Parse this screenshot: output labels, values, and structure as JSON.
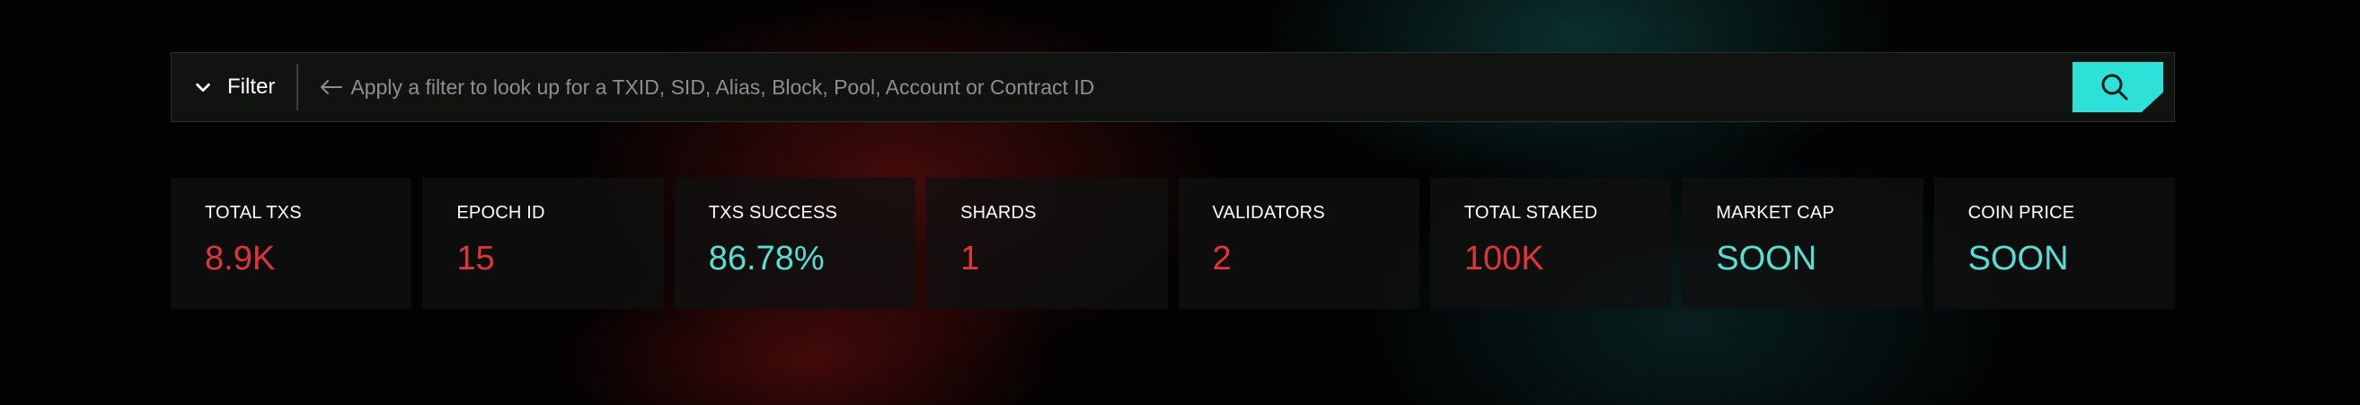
{
  "search": {
    "filter_label": "Filter",
    "placeholder": "Apply a filter to look up for a TXID, SID, Alias, Block, Pool, Account or Contract ID",
    "icons": {
      "filter_toggle": "chevron-down-icon",
      "hint": "arrow-left-icon",
      "submit": "search-icon"
    }
  },
  "stats": [
    {
      "label": "TOTAL TXS",
      "value": "8.9K",
      "color": "#e03535"
    },
    {
      "label": "EPOCH ID",
      "value": "15",
      "color": "#e03535"
    },
    {
      "label": "TXS SUCCESS",
      "value": "86.78%",
      "color": "#56dfd3"
    },
    {
      "label": "SHARDS",
      "value": "1",
      "color": "#e03535"
    },
    {
      "label": "VALIDATORS",
      "value": "2",
      "color": "#e03535"
    },
    {
      "label": "TOTAL STAKED",
      "value": "100K",
      "color": "#e03535"
    },
    {
      "label": "MARKET CAP",
      "value": "SOON",
      "color": "#56dfd3"
    },
    {
      "label": "COIN PRICE",
      "value": "SOON",
      "color": "#56dfd3"
    }
  ],
  "colors": {
    "accent": "#2de0d8",
    "negative_value": "#e03535",
    "positive_value": "#56dfd3",
    "background": "#020202"
  }
}
